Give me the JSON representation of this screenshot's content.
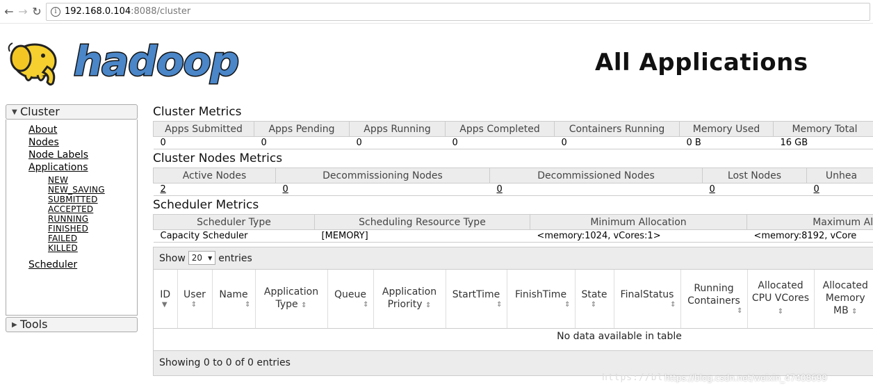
{
  "browser": {
    "url_host": "192.168.0.104",
    "url_path": ":8088/cluster",
    "info_glyph": "i"
  },
  "header": {
    "logo_text": "hadoop",
    "title": "All Applications"
  },
  "sidebar": {
    "cluster_label": "Cluster",
    "links": [
      "About",
      "Nodes",
      "Node Labels",
      "Applications"
    ],
    "app_states": [
      "NEW",
      "NEW_SAVING",
      "SUBMITTED",
      "ACCEPTED",
      "RUNNING",
      "FINISHED",
      "FAILED",
      "KILLED"
    ],
    "scheduler_label": "Scheduler",
    "tools_label": "Tools"
  },
  "cluster_metrics": {
    "title": "Cluster Metrics",
    "headers": [
      "Apps Submitted",
      "Apps Pending",
      "Apps Running",
      "Apps Completed",
      "Containers Running",
      "Memory Used",
      "Memory Total"
    ],
    "values": [
      "0",
      "0",
      "0",
      "0",
      "0",
      "0 B",
      "16 GB"
    ]
  },
  "node_metrics": {
    "title": "Cluster Nodes Metrics",
    "headers": [
      "Active Nodes",
      "Decommissioning Nodes",
      "Decommissioned Nodes",
      "Lost Nodes",
      "Unhea"
    ],
    "values": [
      "2",
      "0",
      "0",
      "0",
      "0"
    ]
  },
  "scheduler_metrics": {
    "title": "Scheduler Metrics",
    "headers": [
      "Scheduler Type",
      "Scheduling Resource Type",
      "Minimum Allocation",
      "Maximum All"
    ],
    "values": [
      "Capacity Scheduler",
      "[MEMORY]",
      "<memory:1024, vCores:1>",
      "<memory:8192, vCore"
    ]
  },
  "apps_table": {
    "show_label": "Show",
    "entries_label": "entries",
    "page_size": "20",
    "columns": [
      {
        "l1": "ID",
        "l2": ""
      },
      {
        "l1": "User",
        "l2": ""
      },
      {
        "l1": "Name",
        "l2": ""
      },
      {
        "l1": "Application",
        "l2": "Type"
      },
      {
        "l1": "Queue",
        "l2": ""
      },
      {
        "l1": "Application",
        "l2": "Priority"
      },
      {
        "l1": "StartTime",
        "l2": ""
      },
      {
        "l1": "FinishTime",
        "l2": ""
      },
      {
        "l1": "State",
        "l2": ""
      },
      {
        "l1": "FinalStatus",
        "l2": ""
      },
      {
        "l1": "Running",
        "l2": "Containers"
      },
      {
        "l1": "Allocated",
        "l2": "CPU VCores"
      },
      {
        "l1": "Allocated",
        "l2": "Memory MB"
      }
    ],
    "empty_message": "No data available in table",
    "footer": "Showing 0 to 0 of 0 entries"
  },
  "watermark": {
    "faint": "https://bl",
    "url": "https://blog.csdn.net/weixin_47408699"
  }
}
